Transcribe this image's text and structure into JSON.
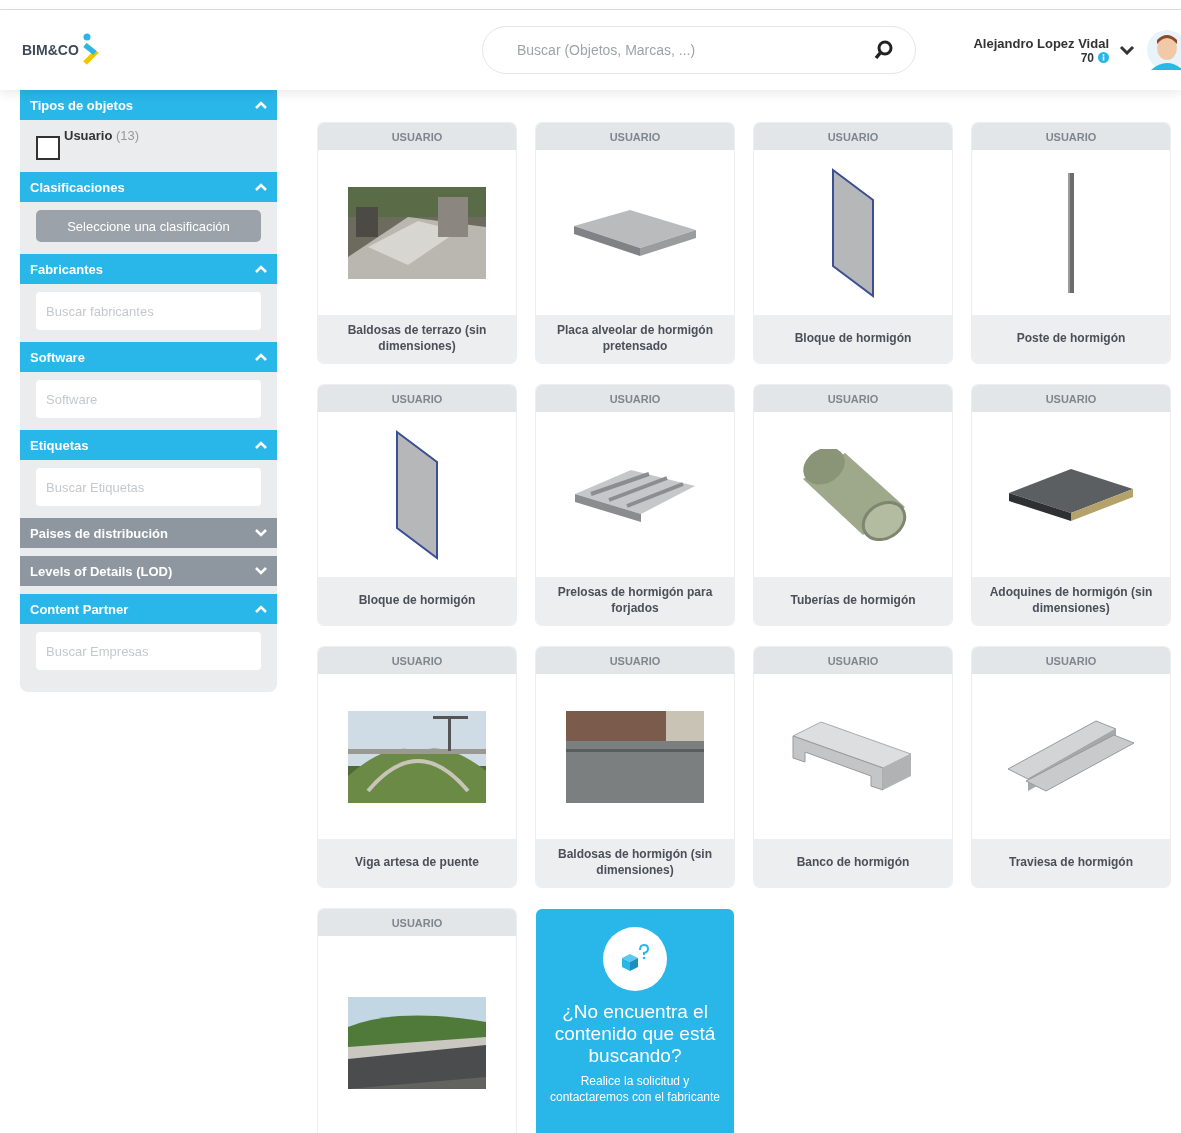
{
  "header": {
    "logo": "BIM&CO",
    "search": {
      "placeholder": "Buscar (Objetos, Marcas, ...)"
    },
    "user": {
      "name": "Alejandro Lopez Vidal",
      "points": "70"
    }
  },
  "sidebar": {
    "sections": [
      {
        "kind": "checklist",
        "title": "Tipos de objetos",
        "expanded": true,
        "items": [
          {
            "label": "Usuario",
            "count": "(13)",
            "checked": false
          }
        ]
      },
      {
        "kind": "button",
        "title": "Clasificaciones",
        "expanded": true,
        "button": "Seleccione una clasificación"
      },
      {
        "kind": "field",
        "title": "Fabricantes",
        "expanded": true,
        "placeholder": "Buscar fabricantes"
      },
      {
        "kind": "field",
        "title": "Software",
        "expanded": true,
        "placeholder": "Software"
      },
      {
        "kind": "field",
        "title": "Etiquetas",
        "expanded": true,
        "placeholder": "Buscar Etiquetas"
      },
      {
        "title": "Paises de distribución",
        "expanded": false
      },
      {
        "title": "Levels of Details (LOD)",
        "expanded": false
      },
      {
        "kind": "field",
        "title": "Content Partner",
        "expanded": true,
        "placeholder": "Buscar Empresas"
      }
    ]
  },
  "cards": [
    {
      "badge": "USUARIO",
      "title": "Baldosas de terrazo (sin dimensiones)",
      "kind": "photo-terrazzo"
    },
    {
      "badge": "USUARIO",
      "title": "Placa alveolar de hormigón pretensado",
      "kind": "slab"
    },
    {
      "badge": "USUARIO",
      "title": "Bloque de hormigón",
      "kind": "panel"
    },
    {
      "badge": "USUARIO",
      "title": "Poste de hormigón",
      "kind": "post"
    },
    {
      "badge": "USUARIO",
      "title": "Bloque de hormigón",
      "kind": "panel"
    },
    {
      "badge": "USUARIO",
      "title": "Prelosas de hormigón para forjados",
      "kind": "ribbed"
    },
    {
      "badge": "USUARIO",
      "title": "Tuberías de hormigón",
      "kind": "pipe"
    },
    {
      "badge": "USUARIO",
      "title": "Adoquines de hormigón (sin dimensiones)",
      "kind": "paver"
    },
    {
      "badge": "USUARIO",
      "title": "Viga artesa de puente",
      "kind": "photo-bridge"
    },
    {
      "badge": "USUARIO",
      "title": "Baldosas de hormigón (sin dimensiones)",
      "kind": "photo-plaza"
    },
    {
      "badge": "USUARIO",
      "title": "Banco de hormigón",
      "kind": "bench"
    },
    {
      "badge": "USUARIO",
      "title": "Traviesa de hormigón",
      "kind": "sleeper"
    },
    {
      "badge": "USUARIO",
      "kind": "photo-road"
    }
  ],
  "request": {
    "title": "¿No encuentra el contenido que está buscando?",
    "text": "Realice la solicitud y contactaremos con el fabricante"
  }
}
